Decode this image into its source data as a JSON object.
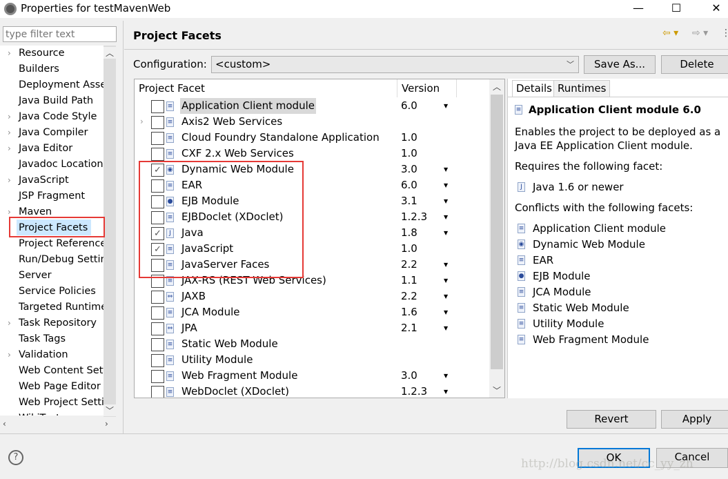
{
  "window": {
    "title": "Properties for testMavenWeb",
    "minimize": "—",
    "maximize": "☐",
    "close": "✕"
  },
  "filter": {
    "placeholder": "type filter text"
  },
  "tree": {
    "items": [
      {
        "label": "Resource",
        "expandable": true
      },
      {
        "label": "Builders",
        "expandable": false
      },
      {
        "label": "Deployment Assembly",
        "expandable": false
      },
      {
        "label": "Java Build Path",
        "expandable": false
      },
      {
        "label": "Java Code Style",
        "expandable": true
      },
      {
        "label": "Java Compiler",
        "expandable": true
      },
      {
        "label": "Java Editor",
        "expandable": true
      },
      {
        "label": "Javadoc Location",
        "expandable": false
      },
      {
        "label": "JavaScript",
        "expandable": true
      },
      {
        "label": "JSP Fragment",
        "expandable": false
      },
      {
        "label": "Maven",
        "expandable": true
      },
      {
        "label": "Project Facets",
        "expandable": false,
        "selected": true
      },
      {
        "label": "Project References",
        "expandable": false
      },
      {
        "label": "Run/Debug Settings",
        "expandable": false
      },
      {
        "label": "Server",
        "expandable": false
      },
      {
        "label": "Service Policies",
        "expandable": false
      },
      {
        "label": "Targeted Runtimes",
        "expandable": false
      },
      {
        "label": "Task Repository",
        "expandable": true
      },
      {
        "label": "Task Tags",
        "expandable": false
      },
      {
        "label": "Validation",
        "expandable": true
      },
      {
        "label": "Web Content Settings",
        "expandable": false
      },
      {
        "label": "Web Page Editor",
        "expandable": false
      },
      {
        "label": "Web Project Settings",
        "expandable": false
      },
      {
        "label": "WikiText",
        "expandable": true
      }
    ]
  },
  "page": {
    "title": "Project Facets",
    "configuration_label": "Configuration:",
    "configuration_value": "<custom>",
    "save_as": "Save As...",
    "delete": "Delete"
  },
  "table": {
    "col_facet": "Project Facet",
    "col_version": "Version",
    "rows": [
      {
        "name": "Application Client module",
        "version": "6.0",
        "checked": false,
        "dropdown": true,
        "icon": "doc"
      },
      {
        "name": "Axis2 Web Services",
        "version": "",
        "checked": false,
        "dropdown": false,
        "icon": "doc",
        "expandable": true
      },
      {
        "name": "Cloud Foundry Standalone Application",
        "version": "1.0",
        "checked": false,
        "dropdown": false,
        "icon": "doc"
      },
      {
        "name": "CXF 2.x Web Services",
        "version": "1.0",
        "checked": false,
        "dropdown": false,
        "icon": "doc"
      },
      {
        "name": "Dynamic Web Module",
        "version": "3.0",
        "checked": true,
        "dropdown": true,
        "icon": "globe"
      },
      {
        "name": "EAR",
        "version": "6.0",
        "checked": false,
        "dropdown": true,
        "icon": "doc"
      },
      {
        "name": "EJB Module",
        "version": "3.1",
        "checked": false,
        "dropdown": true,
        "icon": "bean"
      },
      {
        "name": "EJBDoclet (XDoclet)",
        "version": "1.2.3",
        "checked": false,
        "dropdown": true,
        "icon": "doc"
      },
      {
        "name": "Java",
        "version": "1.8",
        "checked": true,
        "dropdown": true,
        "icon": "java"
      },
      {
        "name": "JavaScript",
        "version": "1.0",
        "checked": true,
        "dropdown": false,
        "icon": "doc"
      },
      {
        "name": "JavaServer Faces",
        "version": "2.2",
        "checked": false,
        "dropdown": true,
        "icon": "doc"
      },
      {
        "name": "JAX-RS (REST Web Services)",
        "version": "1.1",
        "checked": false,
        "dropdown": true,
        "icon": "doc"
      },
      {
        "name": "JAXB",
        "version": "2.2",
        "checked": false,
        "dropdown": true,
        "icon": "arrows"
      },
      {
        "name": "JCA Module",
        "version": "1.6",
        "checked": false,
        "dropdown": true,
        "icon": "doc"
      },
      {
        "name": "JPA",
        "version": "2.1",
        "checked": false,
        "dropdown": true,
        "icon": "arrows"
      },
      {
        "name": "Static Web Module",
        "version": "",
        "checked": false,
        "dropdown": false,
        "icon": "doc"
      },
      {
        "name": "Utility Module",
        "version": "",
        "checked": false,
        "dropdown": false,
        "icon": "doc"
      },
      {
        "name": "Web Fragment Module",
        "version": "3.0",
        "checked": false,
        "dropdown": true,
        "icon": "doc"
      },
      {
        "name": "WebDoclet (XDoclet)",
        "version": "1.2.3",
        "checked": false,
        "dropdown": true,
        "icon": "doc"
      }
    ]
  },
  "details": {
    "tab_details": "Details",
    "tab_runtimes": "Runtimes",
    "heading": "Application Client module 6.0",
    "description_line1": "Enables the project to be deployed as a",
    "description_line2": "Java EE Application Client module.",
    "requires_label": "Requires the following facet:",
    "requires": [
      "Java 1.6 or newer"
    ],
    "conflicts_label": "Conflicts with the following facets:",
    "conflicts": [
      "Application Client module",
      "Dynamic Web Module",
      "EAR",
      "EJB Module",
      "JCA Module",
      "Static Web Module",
      "Utility Module",
      "Web Fragment Module"
    ]
  },
  "buttons": {
    "revert": "Revert",
    "apply": "Apply",
    "ok": "OK",
    "cancel": "Cancel",
    "help": "?"
  },
  "watermark": "http://blog.csdn.net/cc_yy_zh",
  "colors": {
    "highlight": "#e53935",
    "selection": "#cce8ff",
    "ok_border": "#0078d7"
  }
}
